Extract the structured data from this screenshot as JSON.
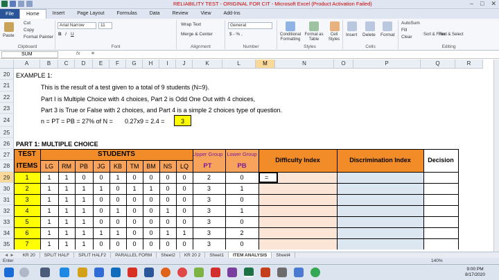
{
  "window": {
    "title": "RELIABILITY TEST - ORIGINAL FOR CIT - Microsoft Excel (Product Activation Failed)"
  },
  "ribbon_tabs": [
    "File",
    "Home",
    "Insert",
    "Page Layout",
    "Formulas",
    "Data",
    "Review",
    "View",
    "Add-Ins"
  ],
  "ribbon": {
    "clipboard": {
      "paste": "Paste",
      "cut": "Cut",
      "copy": "Copy",
      "format_painter": "Format Painter",
      "label": "Clipboard"
    },
    "font": {
      "name": "Arial Narrow",
      "size": "11",
      "label": "Font"
    },
    "alignment": {
      "wrap": "Wrap Text",
      "merge": "Merge & Center",
      "label": "Alignment"
    },
    "number": {
      "format": "General",
      "label": "Number"
    },
    "styles": {
      "conditional": "Conditional Formatting",
      "format_table": "Format as Table",
      "cell_styles": "Cell Styles",
      "label": "Styles"
    },
    "cells": {
      "insert": "Insert",
      "delete": "Delete",
      "format": "Format",
      "label": "Cells"
    },
    "editing": {
      "autosum": "AutoSum",
      "fill": "Fill",
      "clear": "Clear",
      "sort": "Sort & Filter",
      "find": "Find & Select",
      "label": "Editing"
    }
  },
  "formula_bar": {
    "name_box": "SUM",
    "fx": "fx",
    "content": "="
  },
  "columns": [
    "A",
    "B",
    "C",
    "D",
    "E",
    "F",
    "G",
    "H",
    "I",
    "J",
    "K",
    "L",
    "M",
    "N",
    "O",
    "P",
    "Q",
    "R"
  ],
  "rows": [
    "20",
    "21",
    "22",
    "23",
    "24",
    "25",
    "26",
    "27",
    "28",
    "29",
    "30",
    "31",
    "32",
    "33",
    "34",
    "35"
  ],
  "text": {
    "example": "EXAMPLE 1:",
    "line21": "This is the result of a test given to a total of 9 students (N=9).",
    "line22": "Part I is Multiple Choice with 4 choices, Part 2 is Odd One Out with 4 choices,",
    "line23": "Part 3 is True or False with 2 choices, and Part 4 is a simple 2 choices type of question.",
    "line24a": "n = PT = PB = 27% of N =",
    "line24b": "0.27x9 = 2.4 =",
    "line24c": "3",
    "part1": "PART 1: MULTIPLE CHOICE"
  },
  "table": {
    "test": "TEST",
    "items": "ITEMS",
    "students": "STUDENTS",
    "upper": "Upper Group",
    "lower": "Lower Group",
    "pt": "PT",
    "pb": "PB",
    "difficulty": "Difficulty Index",
    "discrimination": "Discrimination Index",
    "decision": "Decision",
    "student_names": [
      "LG",
      "RM",
      "PB",
      "JG",
      "KB",
      "TM",
      "BM",
      "NS",
      "LQ"
    ],
    "active_cell": "=",
    "rows": [
      {
        "item": "1",
        "scores": [
          "1",
          "1",
          "0",
          "0",
          "1",
          "0",
          "0",
          "0",
          "0"
        ],
        "pt": "2",
        "pb": "0"
      },
      {
        "item": "2",
        "scores": [
          "1",
          "1",
          "1",
          "1",
          "0",
          "1",
          "1",
          "0",
          "0"
        ],
        "pt": "3",
        "pb": "1"
      },
      {
        "item": "3",
        "scores": [
          "1",
          "1",
          "1",
          "0",
          "0",
          "0",
          "0",
          "0",
          "0"
        ],
        "pt": "3",
        "pb": "0"
      },
      {
        "item": "4",
        "scores": [
          "1",
          "1",
          "1",
          "0",
          "1",
          "0",
          "0",
          "1",
          "0"
        ],
        "pt": "3",
        "pb": "1"
      },
      {
        "item": "5",
        "scores": [
          "1",
          "1",
          "1",
          "0",
          "0",
          "0",
          "0",
          "0",
          "0"
        ],
        "pt": "3",
        "pb": "0"
      },
      {
        "item": "6",
        "scores": [
          "1",
          "1",
          "1",
          "1",
          "1",
          "0",
          "0",
          "1",
          "1"
        ],
        "pt": "3",
        "pb": "2"
      },
      {
        "item": "7",
        "scores": [
          "1",
          "1",
          "1",
          "0",
          "0",
          "0",
          "0",
          "0",
          "0"
        ],
        "pt": "3",
        "pb": "0"
      }
    ]
  },
  "sheet_tabs": [
    "KR 20",
    "SPLIT HALF",
    "SPLIT HALF2",
    "PARALLEL FORM",
    "Sheet2",
    "KR 20 2",
    "Sheet1",
    "ITEM ANALYSIS",
    "Sheet4"
  ],
  "active_sheet": "ITEM ANALYSIS",
  "status": {
    "mode": "Enter",
    "zoom": "140%"
  },
  "clock": {
    "time": "9:00 PM",
    "date": "8/17/2020"
  },
  "colors": {
    "orange": "#f7a35c",
    "orange_dark": "#f28c28",
    "yellow": "#ffff00",
    "peach": "#fbe5d6",
    "blue_light": "#dce6f1",
    "selection": "#f9d99a"
  }
}
